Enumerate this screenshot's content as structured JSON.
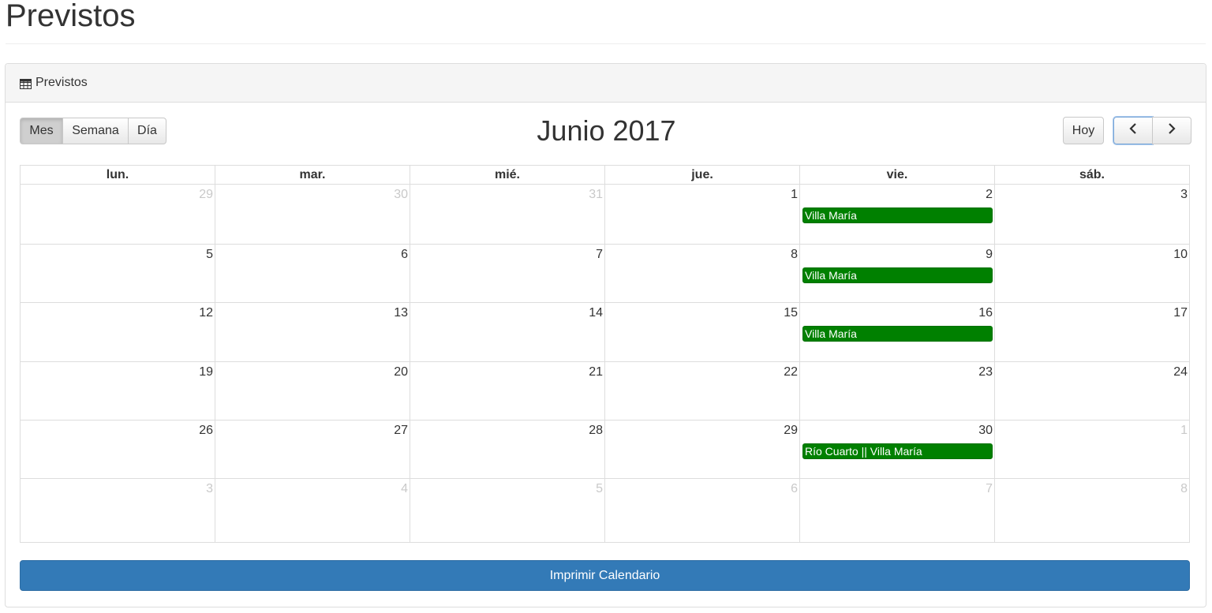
{
  "page": {
    "title": "Previstos"
  },
  "panel": {
    "heading": "Previstos",
    "heading_icon": "table-icon"
  },
  "toolbar": {
    "views": [
      {
        "label": "Mes",
        "active": true
      },
      {
        "label": "Semana",
        "active": false
      },
      {
        "label": "Día",
        "active": false
      }
    ],
    "title": "Junio 2017",
    "today_label": "Hoy",
    "prev_icon": "chevron-left-icon",
    "next_icon": "chevron-right-icon"
  },
  "calendar": {
    "weekdays": [
      "lun.",
      "mar.",
      "mié.",
      "jue.",
      "vie.",
      "sáb."
    ],
    "weeks": [
      [
        {
          "day": "29",
          "other": true
        },
        {
          "day": "30",
          "other": true
        },
        {
          "day": "31",
          "other": true
        },
        {
          "day": "1"
        },
        {
          "day": "2",
          "events": [
            "Villa María"
          ]
        },
        {
          "day": "3"
        }
      ],
      [
        {
          "day": "5"
        },
        {
          "day": "6"
        },
        {
          "day": "7"
        },
        {
          "day": "8"
        },
        {
          "day": "9",
          "events": [
            "Villa María"
          ]
        },
        {
          "day": "10"
        }
      ],
      [
        {
          "day": "12"
        },
        {
          "day": "13"
        },
        {
          "day": "14"
        },
        {
          "day": "15"
        },
        {
          "day": "16",
          "events": [
            "Villa María"
          ]
        },
        {
          "day": "17"
        }
      ],
      [
        {
          "day": "19"
        },
        {
          "day": "20"
        },
        {
          "day": "21"
        },
        {
          "day": "22"
        },
        {
          "day": "23"
        },
        {
          "day": "24"
        }
      ],
      [
        {
          "day": "26"
        },
        {
          "day": "27"
        },
        {
          "day": "28"
        },
        {
          "day": "29"
        },
        {
          "day": "30",
          "events": [
            "Río Cuarto || Villa María"
          ]
        },
        {
          "day": "1",
          "other": true
        }
      ],
      [
        {
          "day": "3",
          "other": true
        },
        {
          "day": "4",
          "other": true
        },
        {
          "day": "5",
          "other": true
        },
        {
          "day": "6",
          "other": true
        },
        {
          "day": "7",
          "other": true
        },
        {
          "day": "8",
          "other": true
        }
      ]
    ],
    "event_color": "#008000"
  },
  "print_button": {
    "label": "Imprimir Calendario",
    "color": "#337ab7"
  }
}
